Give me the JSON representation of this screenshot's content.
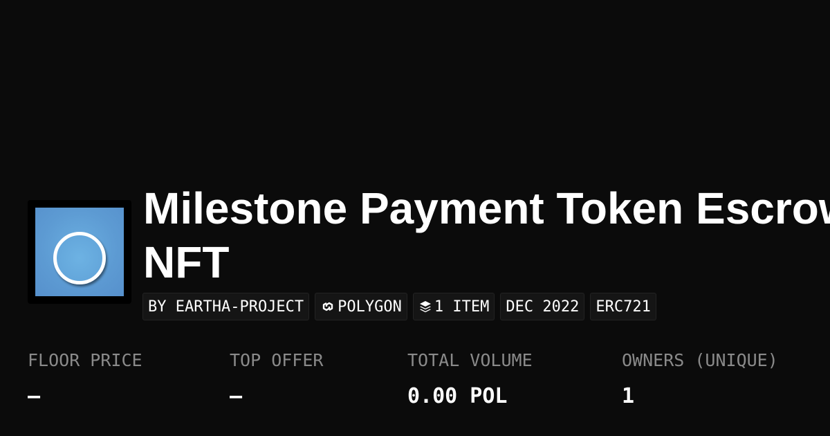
{
  "collection": {
    "title_line1": "Milestone Payment Token Escrow",
    "title_line2": "NFT"
  },
  "badges": {
    "creator": "BY EARTHA-PROJECT",
    "chain": "POLYGON",
    "items": "1 ITEM",
    "date": "DEC 2022",
    "standard": "ERC721"
  },
  "icons": {
    "chain": "polygon-link-icon",
    "items": "layers-icon",
    "avatar": "circle-ring-logo"
  },
  "stats": [
    {
      "label": "FLOOR PRICE",
      "value": "–"
    },
    {
      "label": "TOP OFFER",
      "value": "–"
    },
    {
      "label": "TOTAL VOLUME",
      "value": "0.00 POL"
    },
    {
      "label": "OWNERS (UNIQUE)",
      "value": "1"
    }
  ],
  "colors": {
    "background": "#0b0b0b",
    "avatar_blue": "#5d9bd3",
    "label_gray": "#8a8a8a",
    "text": "#ffffff"
  }
}
